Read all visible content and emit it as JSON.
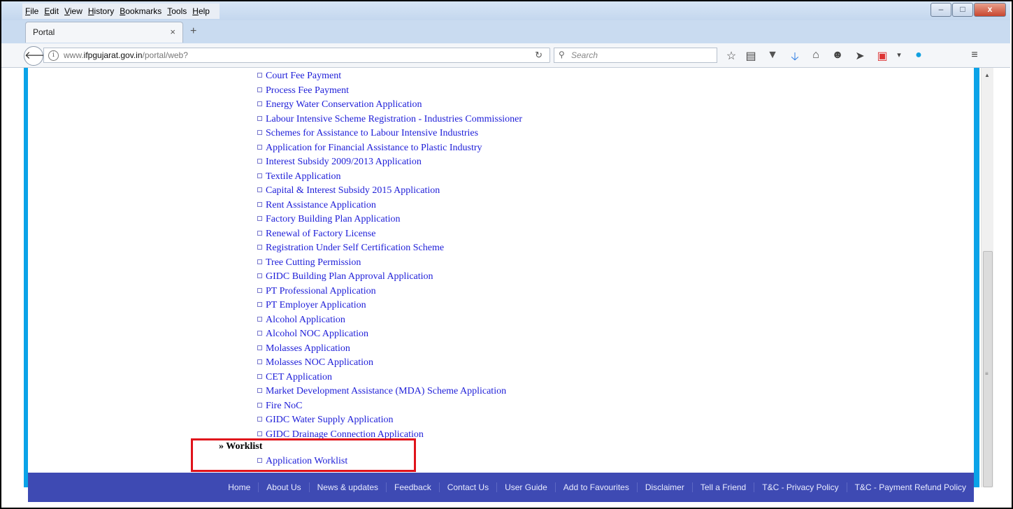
{
  "menu": [
    "File",
    "Edit",
    "View",
    "History",
    "Bookmarks",
    "Tools",
    "Help"
  ],
  "window_controls": {
    "minimize": "–",
    "maximize": "□",
    "close": "x"
  },
  "tab": {
    "title": "Portal",
    "close": "×",
    "new_tab": "+"
  },
  "url": {
    "prefix": "www.",
    "domain": "ifpgujarat.gov.in",
    "path": "/portal/web?"
  },
  "search": {
    "placeholder": "Search"
  },
  "links": [
    "Court Fee Payment",
    "Process Fee Payment",
    "Energy Water Conservation Application",
    "Labour Intensive Scheme Registration - Industries Commissioner",
    "Schemes for Assistance to Labour Intensive Industries",
    "Application for Financial Assistance to Plastic Industry",
    "Interest Subsidy 2009/2013 Application",
    "Textile Application",
    "Capital & Interest Subsidy 2015 Application",
    "Rent Assistance Application",
    "Factory Building Plan Application",
    "Renewal of Factory License",
    "Registration Under Self Certification Scheme",
    "Tree Cutting Permission",
    "GIDC Building Plan Approval Application",
    "PT Professional Application",
    "PT Employer Application",
    "Alcohol Application",
    "Alcohol NOC Application",
    "Molasses Application",
    "Molasses NOC Application",
    "CET Application",
    "Market Development Assistance (MDA) Scheme Application",
    "Fire NoC",
    "GIDC Water Supply Application",
    "GIDC Drainage Connection Application"
  ],
  "worklist": {
    "heading": "» Worklist",
    "item": "Application Worklist"
  },
  "footer": [
    "Home",
    "About Us",
    "News & updates",
    "Feedback",
    "Contact Us",
    "User Guide",
    "Add to Favourites",
    "Disclaimer",
    "Tell a Friend",
    "T&C - Privacy Policy",
    "T&C - Payment Refund Policy"
  ],
  "colors": {
    "accent_border": "#0aa3e8",
    "footer_bg": "#3e4ab3",
    "link": "#1d1dd8",
    "highlight": "#e0131b"
  }
}
